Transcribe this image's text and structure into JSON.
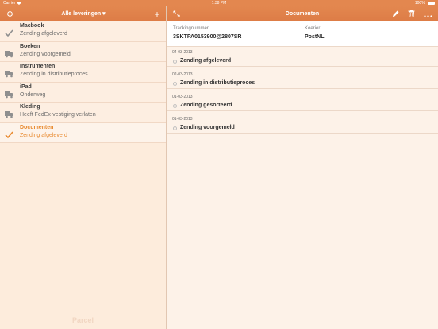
{
  "statusbar": {
    "carrier": "Carrier",
    "time": "1:38 PM",
    "battery": "100%"
  },
  "sidebar": {
    "title": "Alle leveringen ▾",
    "add_label": "+",
    "brand": "Parcel",
    "items": [
      {
        "title": "Macbook",
        "status": "Zending afgeleverd",
        "icon": "check-icon"
      },
      {
        "title": "Boeken",
        "status": "Zending voorgemeld",
        "icon": "truck-icon"
      },
      {
        "title": "Instrumenten",
        "status": "Zending in distributieproces",
        "icon": "truck-icon"
      },
      {
        "title": "iPad",
        "status": "Onderweg",
        "icon": "truck-icon"
      },
      {
        "title": "Kleding",
        "status": "Heeft FedEx-vestiging verlaten",
        "icon": "truck-icon"
      },
      {
        "title": "Documenten",
        "status": "Zending afgeleverd",
        "icon": "check-icon",
        "selected": true
      }
    ]
  },
  "detail": {
    "title": "Documenten",
    "tracking_label": "Trackingnummer",
    "tracking_value": "3SKTPA0153900@2807SR",
    "carrier_label": "Koerier",
    "carrier_value": "PostNL",
    "events": [
      {
        "date": "04-03-2013",
        "text": "Zending afgeleverd"
      },
      {
        "date": "02-03-2013",
        "text": "Zending in distributieproces"
      },
      {
        "date": "01-03-2013",
        "text": "Zending gesorteerd"
      },
      {
        "date": "01-03-2013",
        "text": "Zending voorgemeld"
      }
    ]
  },
  "colors": {
    "accent": "#e3874f",
    "selected_text": "#e8892e"
  }
}
